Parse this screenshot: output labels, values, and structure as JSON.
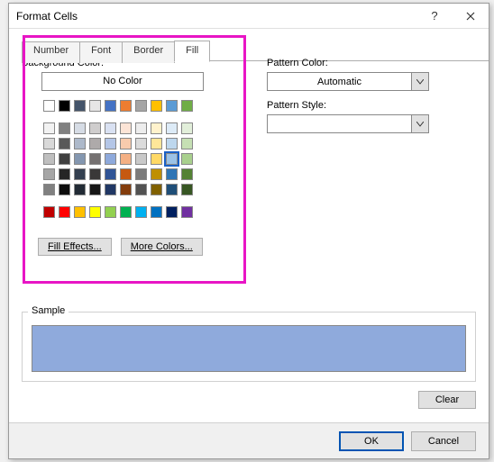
{
  "title": "Format Cells",
  "tabs": [
    "Number",
    "Font",
    "Border",
    "Fill"
  ],
  "active_tab": 3,
  "background_label": "Background Color:",
  "no_color_label": "No Color",
  "fill_effects_label": "Fill Effects...",
  "more_colors_label": "More Colors...",
  "pattern_color_label": "Pattern Color:",
  "pattern_color_value": "Automatic",
  "pattern_style_label": "Pattern Style:",
  "pattern_style_value": "",
  "sample_label": "Sample",
  "sample_color": "#8faadc",
  "clear_label": "Clear",
  "ok_label": "OK",
  "cancel_label": "Cancel",
  "palette": {
    "standard_row": [
      "#ffffff",
      "#000000",
      "#44546a",
      "#e7e6e6",
      "#4472c4",
      "#ed7d31",
      "#a5a5a5",
      "#ffc000",
      "#5b9bd5",
      "#70ad47"
    ],
    "theme_rows": [
      [
        "#f2f2f2",
        "#808080",
        "#d6dce5",
        "#cfcdcd",
        "#d9e1f2",
        "#fce4d6",
        "#ededed",
        "#fff2cc",
        "#ddebf7",
        "#e2efda"
      ],
      [
        "#d9d9d9",
        "#595959",
        "#adb9ca",
        "#aeaaaa",
        "#b4c6e7",
        "#f8cbad",
        "#dbdbdb",
        "#ffe699",
        "#bdd7ee",
        "#c6e0b4"
      ],
      [
        "#bfbfbf",
        "#404040",
        "#8497b0",
        "#757171",
        "#8ea9db",
        "#f4b084",
        "#c9c9c9",
        "#ffd966",
        "#9bc2e6",
        "#a9d08e"
      ],
      [
        "#a6a6a6",
        "#262626",
        "#333f4f",
        "#3a3838",
        "#305496",
        "#c65911",
        "#7b7b7b",
        "#bf8f00",
        "#2f75b5",
        "#548235"
      ],
      [
        "#808080",
        "#0d0d0d",
        "#222b35",
        "#161616",
        "#203764",
        "#833c0c",
        "#525252",
        "#806000",
        "#1f4e78",
        "#375623"
      ]
    ],
    "extra_row": [
      "#c00000",
      "#ff0000",
      "#ffc000",
      "#ffff00",
      "#92d050",
      "#00b050",
      "#00b0f0",
      "#0070c0",
      "#002060",
      "#7030a0"
    ],
    "selected": {
      "row": 2,
      "col": 8
    }
  }
}
